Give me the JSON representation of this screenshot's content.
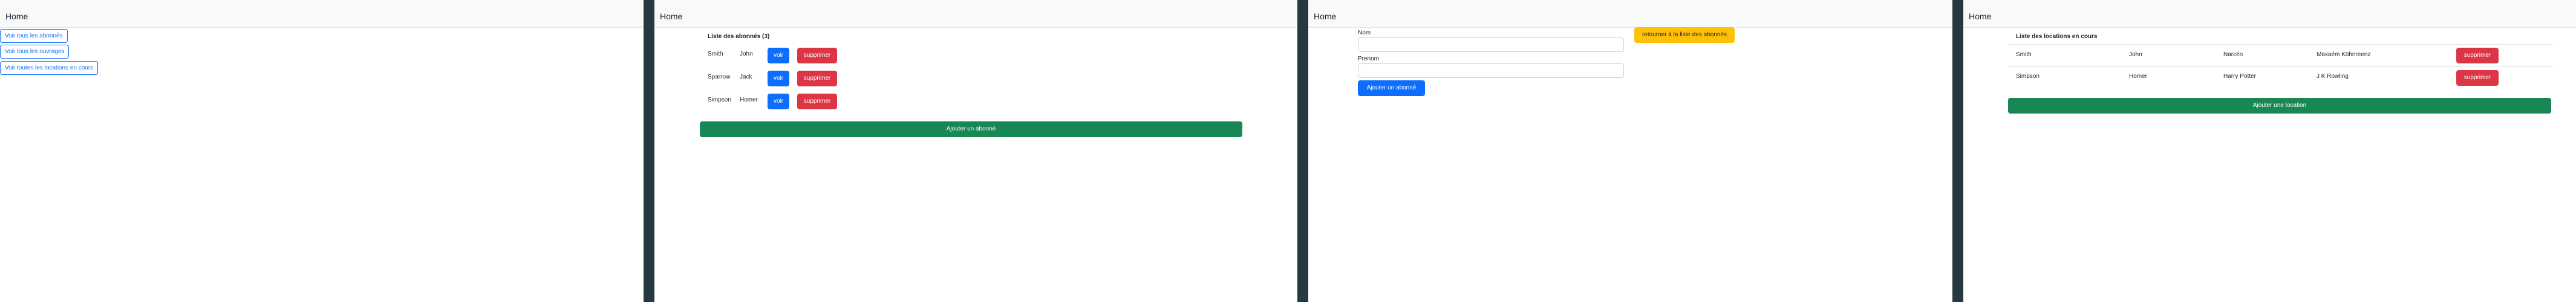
{
  "navbar": {
    "brand": "Home"
  },
  "home": {
    "buttons": [
      "Voir tous les abonnés",
      "Voir tous les ouvrages",
      "Voir toutes les locations en cours"
    ]
  },
  "subscribers": {
    "title": "Liste des abonnés (3)",
    "rows": [
      {
        "last": "Smith",
        "first": "John"
      },
      {
        "last": "Sparrow",
        "first": "Jack"
      },
      {
        "last": "Simpson",
        "first": "Homer"
      }
    ],
    "view_label": "voir",
    "delete_label": "supprimer",
    "add_label": "Ajouter un abonné"
  },
  "form": {
    "name_label": "Nom",
    "firstname_label": "Prenom",
    "submit_label": "Ajouter un abonné",
    "back_label": "retourner à la liste des abonnés"
  },
  "rentals": {
    "title": "Liste des locations en cours",
    "rows": [
      {
        "last": "Smith",
        "first": "John",
        "author": "Narcéo",
        "book": "Maxaém Kühnreenz"
      },
      {
        "last": "Simpson",
        "first": "Homer",
        "author": "Harry Potter",
        "book": "J K Rowling"
      }
    ],
    "delete_label": "supprimer",
    "add_label": "Ajouter une location"
  },
  "colors": {
    "primary": "#0d6efd",
    "danger": "#dc3545",
    "success": "#198754",
    "warning": "#ffc107",
    "divider": "#263840"
  }
}
